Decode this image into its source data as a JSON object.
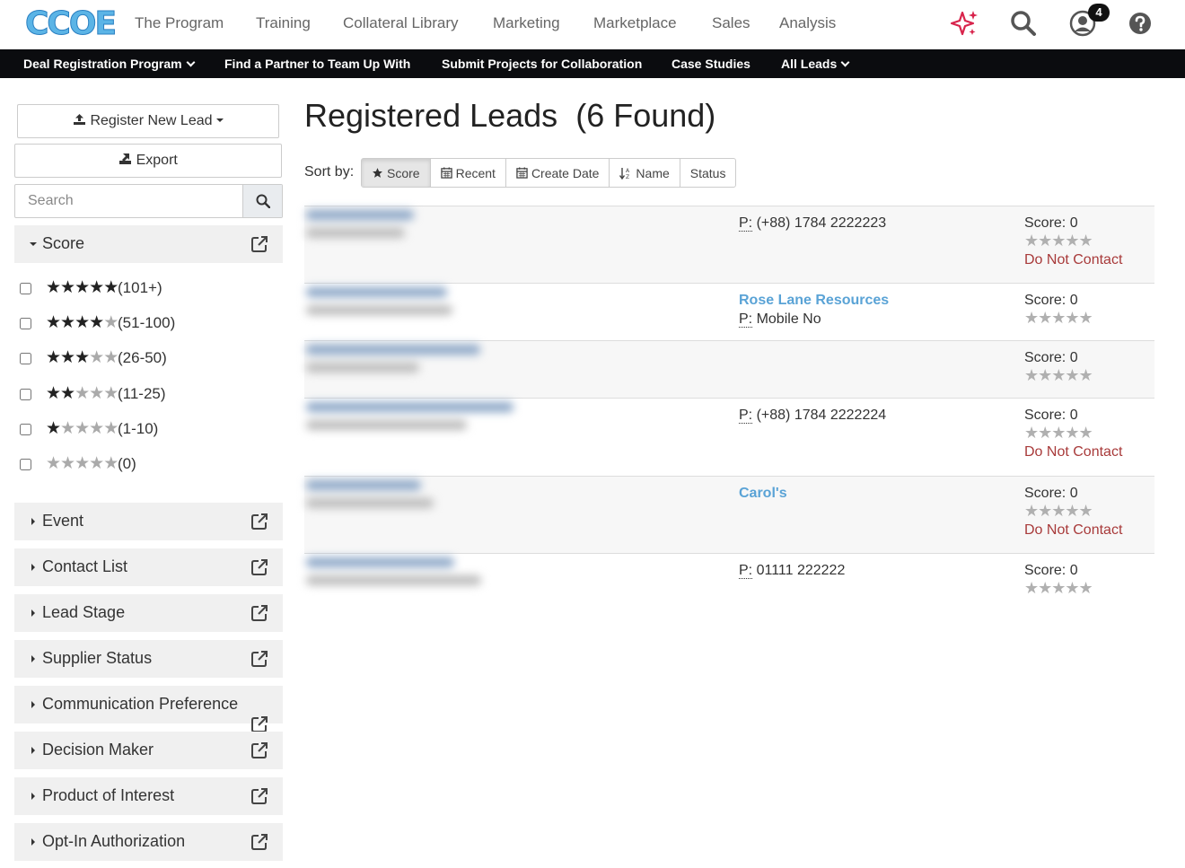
{
  "topnav": {
    "logo_text": "CCOE",
    "items": [
      "The Program",
      "Training",
      "Collateral Library",
      "Marketing",
      "Marketplace",
      "Sales",
      "Analysis"
    ],
    "notification_count": "4",
    "icons": [
      "sparkle-icon",
      "search-icon",
      "user-icon",
      "help-icon"
    ],
    "accent_color": "#d8234b"
  },
  "subnav": {
    "items": [
      "Deal Registration Program",
      "Find a Partner to Team Up With",
      "Submit Projects for Collaboration",
      "Case Studies",
      "All Leads"
    ]
  },
  "sidebar": {
    "register_label": "Register New Lead",
    "export_label": "Export",
    "search_placeholder": "Search",
    "score_facet": {
      "title": "Score",
      "options": [
        {
          "stars": 5,
          "range": "(101+)"
        },
        {
          "stars": 4,
          "range": "(51-100)"
        },
        {
          "stars": 3,
          "range": "(26-50)"
        },
        {
          "stars": 2,
          "range": "(11-25)"
        },
        {
          "stars": 1,
          "range": "(1-10)"
        },
        {
          "stars": 0,
          "range": "(0)"
        }
      ]
    },
    "facets": [
      "Event",
      "Contact List",
      "Lead Stage",
      "Supplier Status",
      "Communication Preference",
      "Decision Maker",
      "Product of Interest",
      "Opt-In Authorization"
    ]
  },
  "main": {
    "title": "Registered Leads",
    "count_text": "(6 Found)",
    "sort_label": "Sort by:",
    "sort_options": [
      "Score",
      "Recent",
      "Create Date",
      "Name",
      "Status"
    ],
    "active_sort": "Score",
    "phone_prefix": "P:",
    "score_prefix": "Score:",
    "leads": [
      {
        "company": "",
        "phone": "(+88) 1784 2222223",
        "score": "0",
        "status": "Do Not Contact"
      },
      {
        "company": "Rose Lane Resources",
        "phone": "Mobile No",
        "score": "0",
        "status": ""
      },
      {
        "company": "",
        "phone": "",
        "score": "0",
        "status": ""
      },
      {
        "company": "",
        "phone": "(+88) 1784 2222224",
        "score": "0",
        "status": "Do Not Contact"
      },
      {
        "company": "Carol's",
        "phone": "",
        "score": "0",
        "status": "Do Not Contact"
      },
      {
        "company": "",
        "phone": "01111 222222",
        "score": "0",
        "status": ""
      }
    ]
  }
}
